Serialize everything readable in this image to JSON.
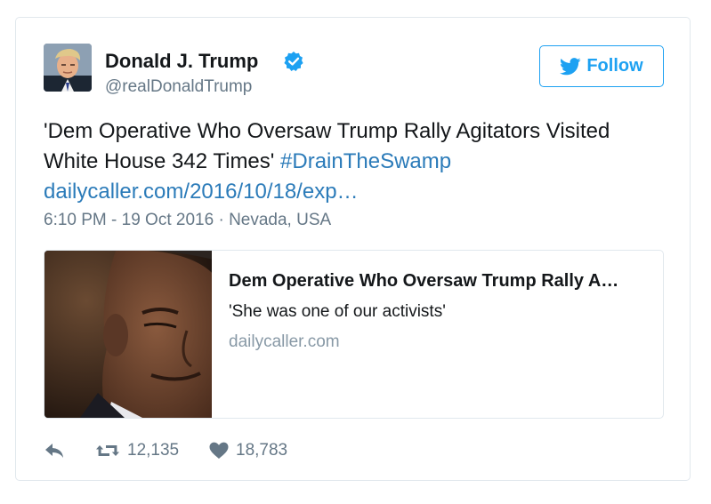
{
  "author": {
    "name": "Donald J. Trump",
    "handle": "@realDonaldTrump",
    "verified": true
  },
  "follow_label": "Follow",
  "tweet": {
    "text": "'Dem Operative Who Oversaw Trump Rally Agitators Visited White House 342 Times'",
    "hashtag": "#DrainTheSwamp",
    "link": "dailycaller.com/2016/10/18/exp…",
    "timestamp": "6:10 PM - 19 Oct 2016",
    "separator": "·",
    "location": "Nevada, USA"
  },
  "card": {
    "title": "Dem Operative Who Oversaw Trump Rally A…",
    "description": "'She was one of our activists'",
    "domain": "dailycaller.com"
  },
  "actions": {
    "retweets": "12,135",
    "likes": "18,783"
  },
  "colors": {
    "accent": "#1da1f2",
    "link": "#2b7bb9",
    "muted": "#657786",
    "border": "#e1e8ed"
  },
  "icons": {
    "verified": "verified-badge-icon",
    "follow": "bird-icon",
    "reply": "reply-icon",
    "retweet": "retweet-icon",
    "like": "heart-icon"
  }
}
